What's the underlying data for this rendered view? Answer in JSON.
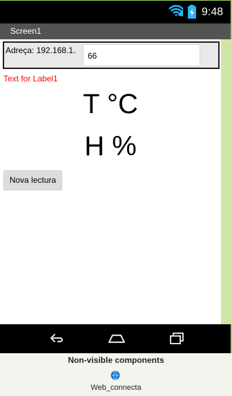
{
  "status_bar": {
    "time": "9:48",
    "wifi_icon": "wifi-icon",
    "battery_icon": "battery-icon"
  },
  "app": {
    "screen_title": "Screen1"
  },
  "address": {
    "label": "Adreça: 192.168.1.",
    "input_value": "66"
  },
  "labels": {
    "label1": "Text for Label1",
    "temperature": "T °C",
    "humidity": "H %"
  },
  "buttons": {
    "refresh_label": "Nova lectura"
  },
  "navigation": {
    "back_icon": "back-icon",
    "home_icon": "home-icon",
    "recent_icon": "recent-apps-icon"
  },
  "non_visible_components": {
    "title": "Non-visible components",
    "items": [
      {
        "label": "Web_connecta",
        "icon": "web-component-icon"
      }
    ]
  },
  "colors": {
    "background": "#f4f4ef",
    "phone_frame": "#cfe7a6",
    "status_bar": "#000000",
    "title_bar": "#535353",
    "content": "#ffffff",
    "label1_text": "#ff0000"
  }
}
